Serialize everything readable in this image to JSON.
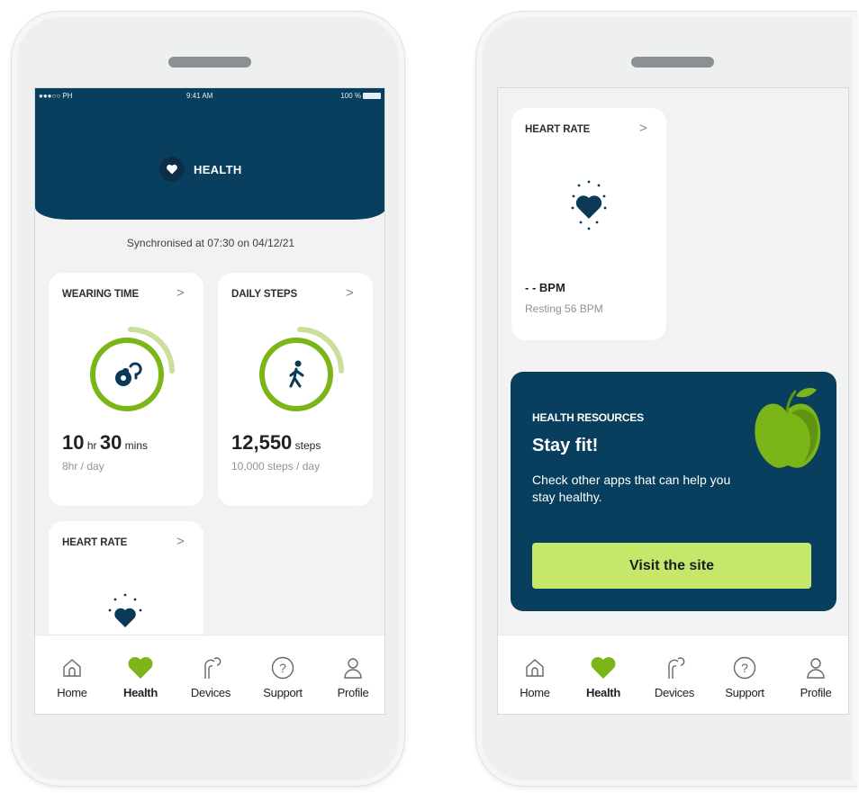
{
  "left_phone": {
    "status_bar": {
      "carrier": "●●●○○ PH",
      "time": "9:41 AM",
      "battery": "100 %"
    },
    "header": {
      "title": "HEALTH"
    },
    "sync_text": "Synchronised at 07:30 on 04/12/21",
    "wearing_time": {
      "title": "WEARING TIME",
      "hours": "10",
      "hours_unit": "hr",
      "mins": "30",
      "mins_unit": "mins",
      "goal": "8hr / day",
      "progress": 1.0
    },
    "daily_steps": {
      "title": "DAILY STEPS",
      "value": "12,550",
      "unit": "steps",
      "goal": "10,000 steps / day",
      "progress": 1.0
    },
    "heart_rate": {
      "title": "HEART RATE"
    }
  },
  "right_phone": {
    "heart_rate": {
      "title": "HEART RATE",
      "value": "- -",
      "unit": "BPM",
      "resting": "Resting 56 BPM"
    },
    "resources": {
      "kicker": "HEALTH RESOURCES",
      "title": "Stay fit!",
      "body": "Check other apps that can help you stay healthy.",
      "button": "Visit the site"
    }
  },
  "nav": {
    "items": [
      {
        "label": "Home",
        "icon": "home-icon"
      },
      {
        "label": "Health",
        "icon": "heart-icon"
      },
      {
        "label": "Devices",
        "icon": "hearing-aid-icon"
      },
      {
        "label": "Support",
        "icon": "help-icon"
      },
      {
        "label": "Profile",
        "icon": "profile-icon"
      }
    ],
    "active": "Health"
  },
  "colors": {
    "navy": "#083e5e",
    "green": "#7cb518",
    "lime": "#c6e86a",
    "background": "#f2f2f2"
  }
}
